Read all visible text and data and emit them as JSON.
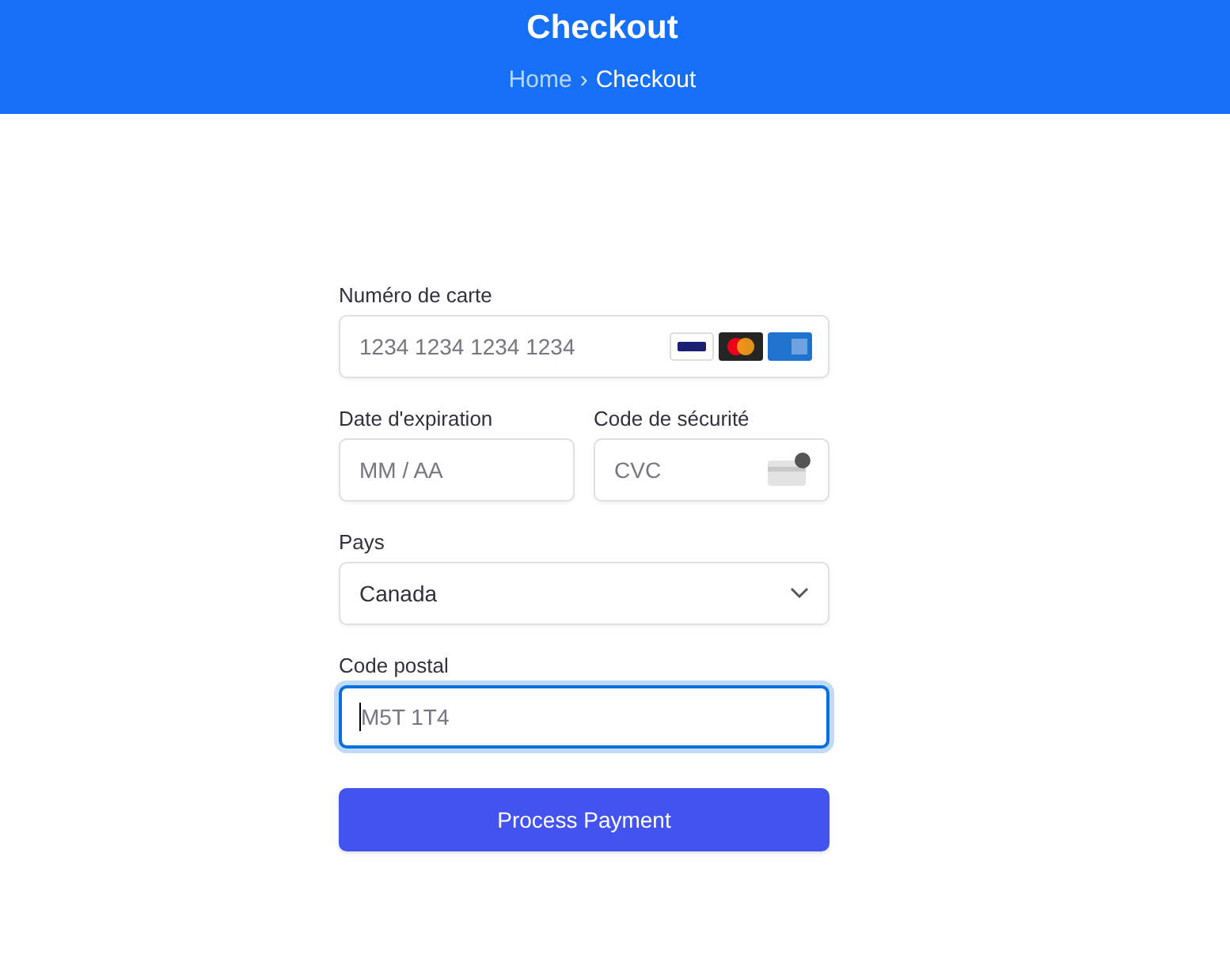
{
  "header": {
    "title": "Checkout",
    "breadcrumb": [
      {
        "label": "Home",
        "current": false
      },
      {
        "label": "Checkout",
        "current": true
      }
    ],
    "separator": "›"
  },
  "form": {
    "card_number": {
      "label": "Numéro de carte",
      "placeholder": "1234 1234 1234 1234"
    },
    "expiry": {
      "label": "Date d'expiration",
      "placeholder": "MM / AA"
    },
    "cvc": {
      "label": "Code de sécurité",
      "placeholder": "CVC"
    },
    "country": {
      "label": "Pays",
      "value": "Canada"
    },
    "postal": {
      "label": "Code postal",
      "placeholder": "M5T 1T4",
      "focused": true
    },
    "submit": "Process Payment"
  }
}
